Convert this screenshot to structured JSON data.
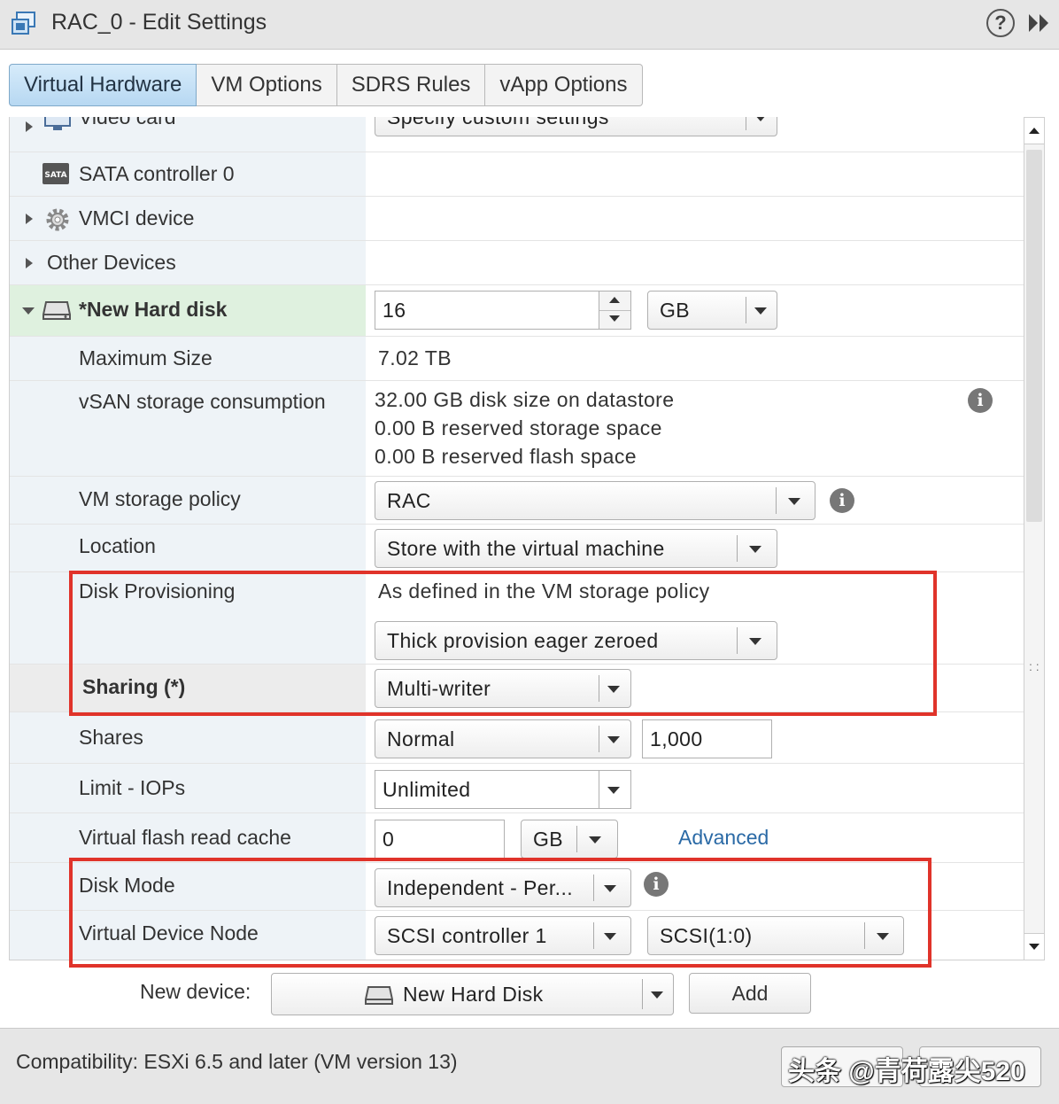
{
  "window": {
    "title": "RAC_0 - Edit Settings",
    "help_label": "?"
  },
  "tabs": [
    {
      "label": "Virtual Hardware",
      "active": true
    },
    {
      "label": "VM Options"
    },
    {
      "label": "SDRS Rules"
    },
    {
      "label": "vApp Options"
    }
  ],
  "rows": {
    "video_card": {
      "label": "Video card",
      "value": "Specify custom settings"
    },
    "sata": {
      "label": "SATA controller 0",
      "icon_text": "SATA"
    },
    "vmci": {
      "label": "VMCI device"
    },
    "other": {
      "label": "Other Devices"
    },
    "hard_disk": {
      "label": "*New Hard disk",
      "size": "16",
      "unit": "GB"
    },
    "max_size": {
      "label": "Maximum Size",
      "value": "7.02 TB"
    },
    "vsan": {
      "label": "vSAN storage consumption",
      "lines": [
        "32.00 GB disk size on datastore",
        "0.00 B reserved storage space",
        "0.00 B reserved flash space"
      ]
    },
    "storage_policy": {
      "label": "VM storage policy",
      "value": "RAC"
    },
    "location": {
      "label": "Location",
      "value": "Store with the virtual machine"
    },
    "disk_provisioning": {
      "label": "Disk Provisioning",
      "note": "As defined in the VM storage policy",
      "value": "Thick provision eager zeroed"
    },
    "sharing": {
      "label": "Sharing (*)",
      "value": "Multi-writer"
    },
    "shares": {
      "label": "Shares",
      "level": "Normal",
      "value": "1,000"
    },
    "limit_iops": {
      "label": "Limit - IOPs",
      "value": "Unlimited"
    },
    "flash_cache": {
      "label": "Virtual flash read cache",
      "value": "0",
      "unit": "GB",
      "link": "Advanced"
    },
    "disk_mode": {
      "label": "Disk Mode",
      "value": "Independent - Per..."
    },
    "device_node": {
      "label": "Virtual Device Node",
      "controller": "SCSI controller 1",
      "node": "SCSI(1:0)"
    }
  },
  "new_device": {
    "label": "New device:",
    "value": "New Hard Disk",
    "add_label": "Add"
  },
  "footer": {
    "compatibility": "Compatibility: ESXi 6.5 and later (VM version 13)"
  },
  "watermark": "头条 @青荷露尖520",
  "colors": {
    "highlight_red": "#e0332a",
    "active_tab": "#b7d8f2",
    "selected_row": "#dff1df",
    "link": "#2b6aa6"
  }
}
